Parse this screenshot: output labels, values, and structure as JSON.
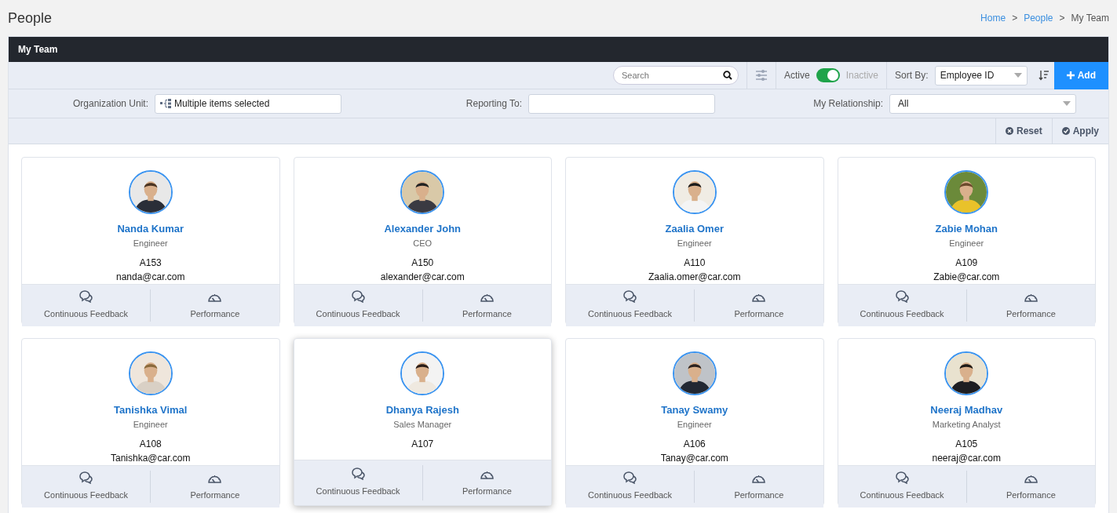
{
  "page": {
    "title": "People"
  },
  "breadcrumb": [
    {
      "label": "Home",
      "link": true,
      "separator": ">"
    },
    {
      "label": "People",
      "link": true,
      "separator": ">"
    },
    {
      "label": "My Team",
      "link": false
    }
  ],
  "panel": {
    "title": "My Team"
  },
  "toolbar": {
    "search": {
      "placeholder": "Search"
    },
    "toggle": {
      "on_label": "Active",
      "off_label": "Inactive",
      "on": true
    },
    "sort": {
      "label": "Sort By:",
      "value": "Employee ID"
    },
    "add_button": "Add"
  },
  "filters": [
    {
      "label": "Organization Unit:",
      "value": "Multiple items selected",
      "kind": "tree"
    },
    {
      "label": "Reporting To:",
      "kind": "text"
    },
    {
      "label": "My Relationship:",
      "value": "All",
      "kind": "select"
    }
  ],
  "actions": [
    "Reset",
    "Apply"
  ],
  "people": [
    {
      "name": "Nanda Kumar",
      "role": "Engineer",
      "id": "A153",
      "email": "nanda@car.com",
      "hovered": false,
      "actions": [
        "Continuous Feedback",
        "Performance"
      ]
    },
    {
      "name": "Alexander John",
      "role": "CEO",
      "id": "A150",
      "email": "alexander@car.com",
      "hovered": false,
      "actions": [
        "Continuous Feedback",
        "Performance"
      ]
    },
    {
      "name": "Zaalia Omer",
      "role": "Engineer",
      "id": "A110",
      "email": "Zaalia.omer@car.com",
      "hovered": false,
      "actions": [
        "Continuous Feedback",
        "Performance"
      ]
    },
    {
      "name": "Zabie Mohan",
      "role": "Engineer",
      "id": "A109",
      "email": "Zabie@car.com",
      "hovered": false,
      "actions": [
        "Continuous Feedback",
        "Performance"
      ]
    },
    {
      "name": "Tanishka Vimal",
      "role": "Engineer",
      "id": "A108",
      "email": "Tanishka@car.com",
      "hovered": false,
      "actions": [
        "Continuous Feedback",
        "Performance"
      ]
    },
    {
      "name": "Dhanya Rajesh",
      "role": "Sales Manager",
      "id": "A107",
      "hovered": true,
      "actions": [
        "Continuous Feedback",
        "Performance"
      ]
    },
    {
      "name": "Tanay Swamy",
      "role": "Engineer",
      "id": "A106",
      "email": "Tanay@car.com",
      "hovered": false,
      "actions": [
        "Continuous Feedback",
        "Performance"
      ]
    },
    {
      "name": "Neeraj Madhav",
      "role": "Marketing Analyst",
      "id": "A105",
      "email": "neeraj@car.com",
      "hovered": false,
      "actions": [
        "Continuous Feedback",
        "Performance"
      ]
    }
  ]
}
